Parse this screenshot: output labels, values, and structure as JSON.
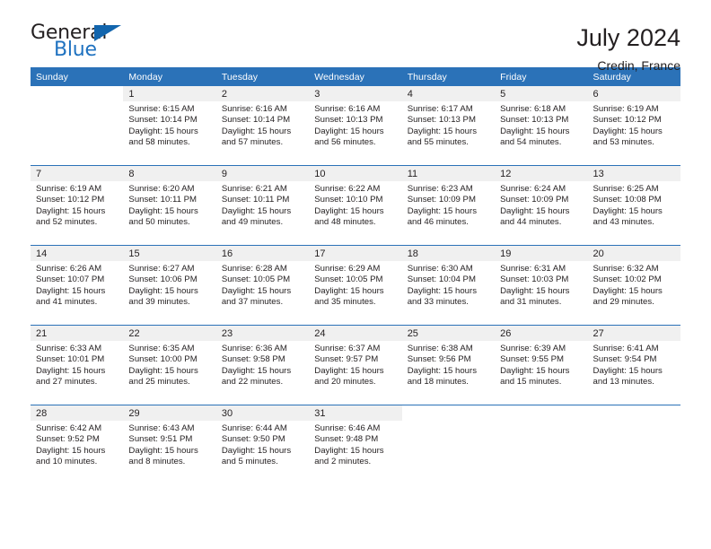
{
  "brand": {
    "name_part1": "General",
    "name_part2": "Blue",
    "logo_icon": "triangle-flag-icon",
    "accent_color": "#1f72c0"
  },
  "header": {
    "title": "July 2024",
    "location": "Credin, France"
  },
  "calendar": {
    "header_bg": "#2b72b8",
    "day_band_bg": "#f0f0f0",
    "weekdays": [
      "Sunday",
      "Monday",
      "Tuesday",
      "Wednesday",
      "Thursday",
      "Friday",
      "Saturday"
    ],
    "weeks": [
      [
        {
          "day": "",
          "lines": []
        },
        {
          "day": "1",
          "lines": [
            "Sunrise: 6:15 AM",
            "Sunset: 10:14 PM",
            "Daylight: 15 hours",
            "and 58 minutes."
          ]
        },
        {
          "day": "2",
          "lines": [
            "Sunrise: 6:16 AM",
            "Sunset: 10:14 PM",
            "Daylight: 15 hours",
            "and 57 minutes."
          ]
        },
        {
          "day": "3",
          "lines": [
            "Sunrise: 6:16 AM",
            "Sunset: 10:13 PM",
            "Daylight: 15 hours",
            "and 56 minutes."
          ]
        },
        {
          "day": "4",
          "lines": [
            "Sunrise: 6:17 AM",
            "Sunset: 10:13 PM",
            "Daylight: 15 hours",
            "and 55 minutes."
          ]
        },
        {
          "day": "5",
          "lines": [
            "Sunrise: 6:18 AM",
            "Sunset: 10:13 PM",
            "Daylight: 15 hours",
            "and 54 minutes."
          ]
        },
        {
          "day": "6",
          "lines": [
            "Sunrise: 6:19 AM",
            "Sunset: 10:12 PM",
            "Daylight: 15 hours",
            "and 53 minutes."
          ]
        }
      ],
      [
        {
          "day": "7",
          "lines": [
            "Sunrise: 6:19 AM",
            "Sunset: 10:12 PM",
            "Daylight: 15 hours",
            "and 52 minutes."
          ]
        },
        {
          "day": "8",
          "lines": [
            "Sunrise: 6:20 AM",
            "Sunset: 10:11 PM",
            "Daylight: 15 hours",
            "and 50 minutes."
          ]
        },
        {
          "day": "9",
          "lines": [
            "Sunrise: 6:21 AM",
            "Sunset: 10:11 PM",
            "Daylight: 15 hours",
            "and 49 minutes."
          ]
        },
        {
          "day": "10",
          "lines": [
            "Sunrise: 6:22 AM",
            "Sunset: 10:10 PM",
            "Daylight: 15 hours",
            "and 48 minutes."
          ]
        },
        {
          "day": "11",
          "lines": [
            "Sunrise: 6:23 AM",
            "Sunset: 10:09 PM",
            "Daylight: 15 hours",
            "and 46 minutes."
          ]
        },
        {
          "day": "12",
          "lines": [
            "Sunrise: 6:24 AM",
            "Sunset: 10:09 PM",
            "Daylight: 15 hours",
            "and 44 minutes."
          ]
        },
        {
          "day": "13",
          "lines": [
            "Sunrise: 6:25 AM",
            "Sunset: 10:08 PM",
            "Daylight: 15 hours",
            "and 43 minutes."
          ]
        }
      ],
      [
        {
          "day": "14",
          "lines": [
            "Sunrise: 6:26 AM",
            "Sunset: 10:07 PM",
            "Daylight: 15 hours",
            "and 41 minutes."
          ]
        },
        {
          "day": "15",
          "lines": [
            "Sunrise: 6:27 AM",
            "Sunset: 10:06 PM",
            "Daylight: 15 hours",
            "and 39 minutes."
          ]
        },
        {
          "day": "16",
          "lines": [
            "Sunrise: 6:28 AM",
            "Sunset: 10:05 PM",
            "Daylight: 15 hours",
            "and 37 minutes."
          ]
        },
        {
          "day": "17",
          "lines": [
            "Sunrise: 6:29 AM",
            "Sunset: 10:05 PM",
            "Daylight: 15 hours",
            "and 35 minutes."
          ]
        },
        {
          "day": "18",
          "lines": [
            "Sunrise: 6:30 AM",
            "Sunset: 10:04 PM",
            "Daylight: 15 hours",
            "and 33 minutes."
          ]
        },
        {
          "day": "19",
          "lines": [
            "Sunrise: 6:31 AM",
            "Sunset: 10:03 PM",
            "Daylight: 15 hours",
            "and 31 minutes."
          ]
        },
        {
          "day": "20",
          "lines": [
            "Sunrise: 6:32 AM",
            "Sunset: 10:02 PM",
            "Daylight: 15 hours",
            "and 29 minutes."
          ]
        }
      ],
      [
        {
          "day": "21",
          "lines": [
            "Sunrise: 6:33 AM",
            "Sunset: 10:01 PM",
            "Daylight: 15 hours",
            "and 27 minutes."
          ]
        },
        {
          "day": "22",
          "lines": [
            "Sunrise: 6:35 AM",
            "Sunset: 10:00 PM",
            "Daylight: 15 hours",
            "and 25 minutes."
          ]
        },
        {
          "day": "23",
          "lines": [
            "Sunrise: 6:36 AM",
            "Sunset: 9:58 PM",
            "Daylight: 15 hours",
            "and 22 minutes."
          ]
        },
        {
          "day": "24",
          "lines": [
            "Sunrise: 6:37 AM",
            "Sunset: 9:57 PM",
            "Daylight: 15 hours",
            "and 20 minutes."
          ]
        },
        {
          "day": "25",
          "lines": [
            "Sunrise: 6:38 AM",
            "Sunset: 9:56 PM",
            "Daylight: 15 hours",
            "and 18 minutes."
          ]
        },
        {
          "day": "26",
          "lines": [
            "Sunrise: 6:39 AM",
            "Sunset: 9:55 PM",
            "Daylight: 15 hours",
            "and 15 minutes."
          ]
        },
        {
          "day": "27",
          "lines": [
            "Sunrise: 6:41 AM",
            "Sunset: 9:54 PM",
            "Daylight: 15 hours",
            "and 13 minutes."
          ]
        }
      ],
      [
        {
          "day": "28",
          "lines": [
            "Sunrise: 6:42 AM",
            "Sunset: 9:52 PM",
            "Daylight: 15 hours",
            "and 10 minutes."
          ]
        },
        {
          "day": "29",
          "lines": [
            "Sunrise: 6:43 AM",
            "Sunset: 9:51 PM",
            "Daylight: 15 hours",
            "and 8 minutes."
          ]
        },
        {
          "day": "30",
          "lines": [
            "Sunrise: 6:44 AM",
            "Sunset: 9:50 PM",
            "Daylight: 15 hours",
            "and 5 minutes."
          ]
        },
        {
          "day": "31",
          "lines": [
            "Sunrise: 6:46 AM",
            "Sunset: 9:48 PM",
            "Daylight: 15 hours",
            "and 2 minutes."
          ]
        },
        {
          "day": "",
          "lines": []
        },
        {
          "day": "",
          "lines": []
        },
        {
          "day": "",
          "lines": []
        }
      ]
    ]
  }
}
